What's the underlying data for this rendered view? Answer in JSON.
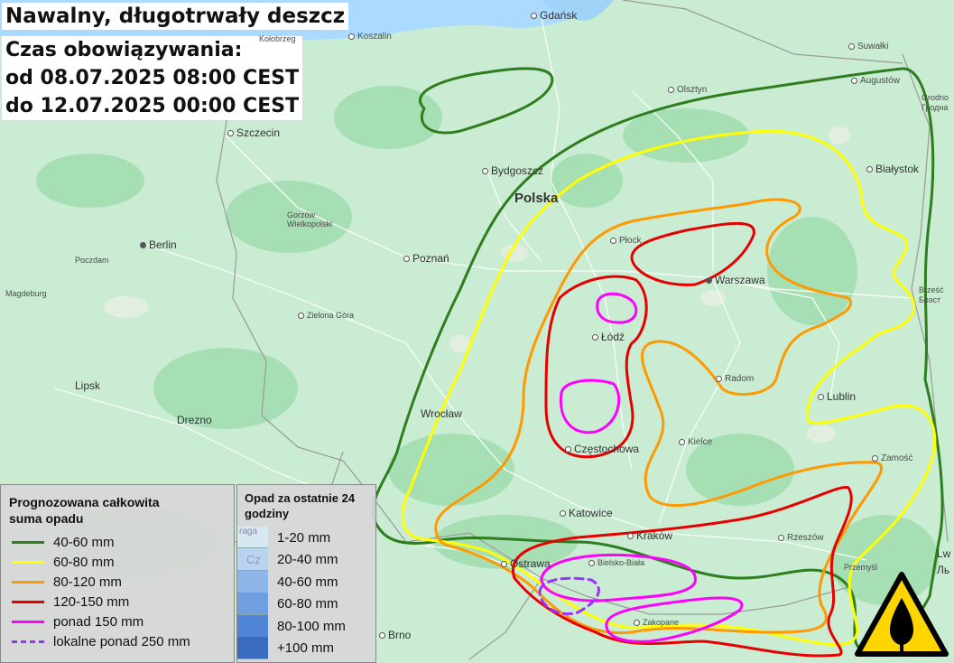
{
  "title": "Nawalny, długotrwały deszcz",
  "validity": {
    "label": "Czas obowiązywania:",
    "from": "od 08.07.2025 08:00 CEST",
    "to": "do 12.07.2025 00:00 CEST"
  },
  "cities": {
    "gdansk": "Gdańsk",
    "kolobrzeg": "Kołobrzeg",
    "koszalin": "Koszalin",
    "suwalki": "Suwałki",
    "olsztyn": "Olsztyn",
    "augustow": "Augustów",
    "grodno": "Grodno",
    "grodno2": "Гродна",
    "szczecin": "Szczecin",
    "bydgoszcz": "Bydgoszcz",
    "bialystok": "Białystok",
    "polska": "Polska",
    "gorzow": "Gorzów",
    "gorzow2": "Wielkopolski",
    "berlin": "Berlin",
    "plock": "Płock",
    "poczdam": "Poczdam",
    "poznan": "Poznań",
    "warszawa": "Warszawa",
    "brzesc": "Brześć",
    "brzesc2": "Брэст",
    "magdeburg": "Magdeburg",
    "zielona": "Zielona Góra",
    "lodz": "Łódź",
    "radom": "Radom",
    "lipsk": "Lipsk",
    "lublin": "Lublin",
    "drezno": "Drezno",
    "wroclaw": "Wrocław",
    "kielce": "Kielce",
    "czestochowa": "Częstochowa",
    "zamosc": "Zamość",
    "katowice": "Katowice",
    "krakow": "Kraków",
    "rzeszow": "Rzeszów",
    "ostrawa": "Ostrawa",
    "bielsko": "Bielsko-Biała",
    "przemysl": "Przemyśl",
    "zakopane": "Zakopane",
    "brno": "Brno",
    "lw": "Lw",
    "lw2": "Ль",
    "praga": "raga",
    "cz": "Cz"
  },
  "legend_forecast": {
    "header": "Prognozowana całkowita suma opadu",
    "items": [
      {
        "label": "40-60 mm",
        "color": "#2e7d1f",
        "style": "solid"
      },
      {
        "label": "60-80 mm",
        "color": "#ffff00",
        "style": "solid"
      },
      {
        "label": "80-120 mm",
        "color": "#ff9900",
        "style": "solid"
      },
      {
        "label": "120-150 mm",
        "color": "#e60000",
        "style": "solid"
      },
      {
        "label": "ponad 150 mm",
        "color": "#ff00ff",
        "style": "solid"
      },
      {
        "label": "lokalne ponad 250 mm",
        "color": "#9933ff",
        "style": "dashed"
      }
    ]
  },
  "legend_24h": {
    "header": "Opad za ostatnie 24 godziny",
    "items": [
      {
        "label": "1-20 mm",
        "color": "#d8e8f3"
      },
      {
        "label": "20-40 mm",
        "color": "#b8d4ee"
      },
      {
        "label": "40-60 mm",
        "color": "#8fb6e8"
      },
      {
        "label": "60-80 mm",
        "color": "#6f9fe0"
      },
      {
        "label": "80-100 mm",
        "color": "#4f84d6"
      },
      {
        "label": "+100 mm",
        "color": "#3a6cc0"
      }
    ]
  },
  "warning_icon": "rain-warning-triangle-icon"
}
